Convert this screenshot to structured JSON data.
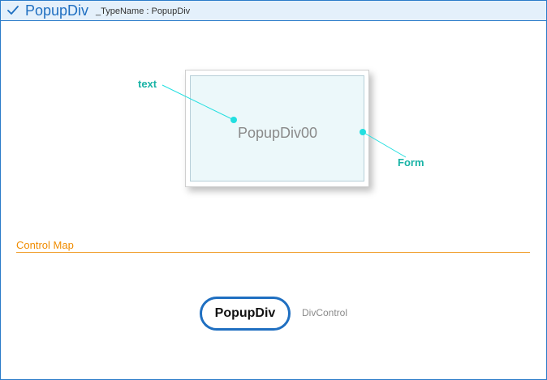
{
  "header": {
    "icon": "check-icon",
    "title": "PopupDiv",
    "typename": "_TypeName : PopupDiv"
  },
  "diagram": {
    "component_text": "PopupDiv00",
    "annotations": {
      "text": "text",
      "form": "Form"
    }
  },
  "control_map": {
    "title": "Control Map",
    "node_label": "PopupDiv",
    "node_description": "DivControl"
  },
  "colors": {
    "accent_blue": "#1f6fc1",
    "annotation_teal": "#19b3a6",
    "connector_cyan": "#22dfe0",
    "control_map_orange": "#f08c00"
  }
}
